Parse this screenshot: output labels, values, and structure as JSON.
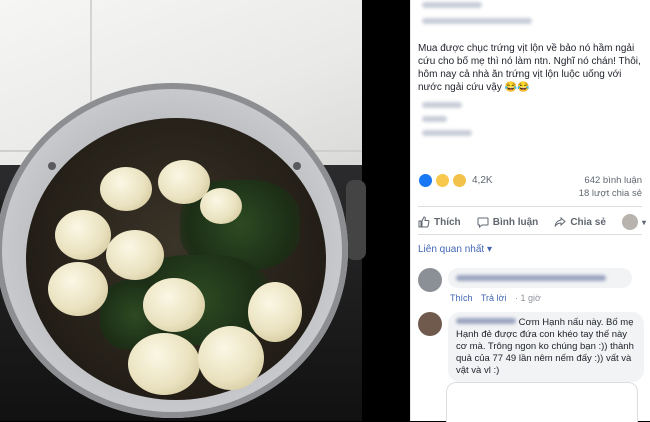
{
  "post": {
    "text": "Mua được chục trứng vịt lộn về bảo nó hầm ngải cứu cho bố mẹ thì nó làm ntn. Nghĩ nó chán! Thôi, hôm nay cả nhà ăn trứng vịt lộn luộc uống với nước ngải cứu vậy 😂😂"
  },
  "reactions": {
    "count": "4,2K",
    "comments": "642 bình luận",
    "shares": "18 lượt chia sẻ"
  },
  "actions": {
    "like": "Thích",
    "comment": "Bình luận",
    "share": "Chia sẻ"
  },
  "filter": {
    "label": "Liên quan nhất ▾"
  },
  "comments": [
    {
      "like_label": "Thích",
      "reply_label": "Trả lời",
      "time": "· 1 giờ"
    },
    {
      "text": "Cơm Hạnh nấu này. Bố mẹ Hạnh đẻ được đứa con khéo tay thế này cơ mà. Trông ngon ko chúng bạn :)) thành quả của 77 49 lần nêm nếm đấy :)) vất và vật và vl :)"
    }
  ],
  "colors": {
    "link": "#4267b2",
    "text": "#1d2129",
    "muted": "#606770"
  }
}
